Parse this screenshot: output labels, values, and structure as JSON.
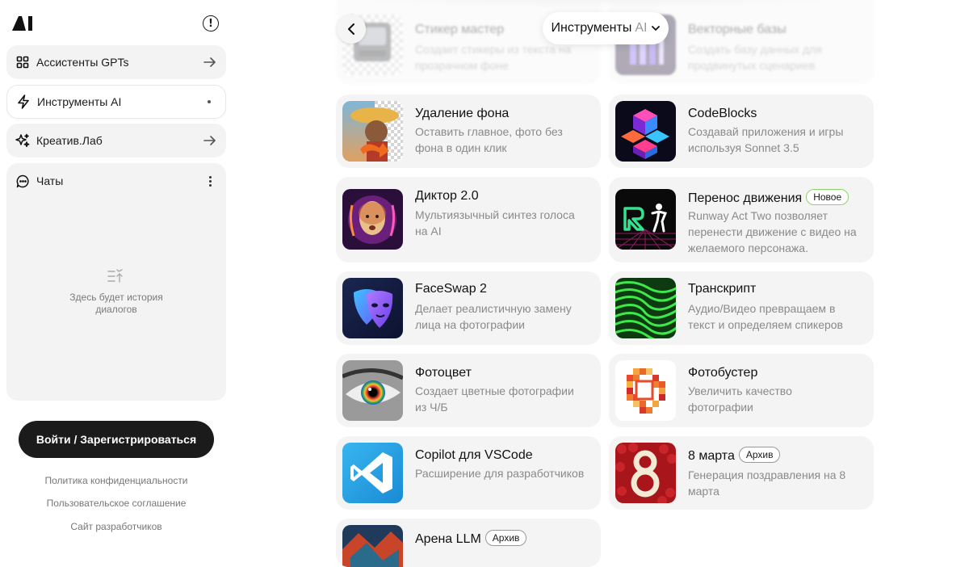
{
  "sidebar": {
    "logo": "AI",
    "info_icon": "!",
    "nav": [
      {
        "label": "Ассистенты GPTs",
        "icon": "grid-icon",
        "trail": "arrow-right-icon"
      },
      {
        "label": "Инструменты AI",
        "icon": "bolt-icon",
        "trail": "dot-icon"
      },
      {
        "label": "Креатив.Лаб",
        "icon": "sparkle-icon",
        "trail": "arrow-right-icon"
      }
    ],
    "chats": {
      "title": "Чаты",
      "empty_line1": "Здесь будет история",
      "empty_line2": "диалогов"
    },
    "login_label": "Войти / Зарегистрироваться",
    "footer_links": [
      "Политика конфиденциальности",
      "Пользовательское соглашение",
      "Сайт разработчиков"
    ]
  },
  "header": {
    "section_label": "Инструменты",
    "section_suffix": "AI"
  },
  "cards": [
    {
      "title": "Стикер мастер",
      "desc1": "Создает стикеры из текста на",
      "desc2": "прозрачном фоне",
      "badge": ""
    },
    {
      "title": "Векторные базы",
      "desc1": "Создать базу данных для",
      "desc2": "продвинутых сценариев",
      "badge": ""
    },
    {
      "title": "Удаление фона",
      "desc1": "Оставить главное, фото без",
      "desc2": "фона в один клик",
      "badge": ""
    },
    {
      "title": "CodeBlocks",
      "desc1": "Создавай приложения и игры",
      "desc2": "используя Sonnet 3.5",
      "badge": ""
    },
    {
      "title": "Диктор 2.0",
      "desc1": "Мультиязычный синтез голоса",
      "desc2": "на AI",
      "badge": ""
    },
    {
      "title": "Перенос движения",
      "desc1": "Runway Act Two позволяет",
      "desc2": "перенести движение с видео на",
      "desc3": "желаемого персонажа.",
      "badge": "Новое"
    },
    {
      "title": "FaceSwap 2",
      "desc1": "Делает реалистичную замену",
      "desc2": "лица на фотографии",
      "badge": ""
    },
    {
      "title": "Транскрипт",
      "desc1": "Аудио/Видео превращаем в",
      "desc2": "текст и определяем спикеров",
      "badge": ""
    },
    {
      "title": "Фотоцвет",
      "desc1": "Создает цветные фотографии",
      "desc2": "из Ч/Б",
      "badge": ""
    },
    {
      "title": "Фотобустер",
      "desc1": "Увеличить качество",
      "desc2": "фотографии",
      "badge": ""
    },
    {
      "title": "Copilot для VSCode",
      "desc1": "Расширение для разработчиков",
      "desc2": "",
      "badge": ""
    },
    {
      "title": "8 марта",
      "desc1": "Генерация поздравления на 8",
      "desc2": "марта",
      "badge": "Архив"
    },
    {
      "title": "Арена LLM",
      "desc1": "",
      "desc2": "",
      "badge": "Архив"
    }
  ]
}
